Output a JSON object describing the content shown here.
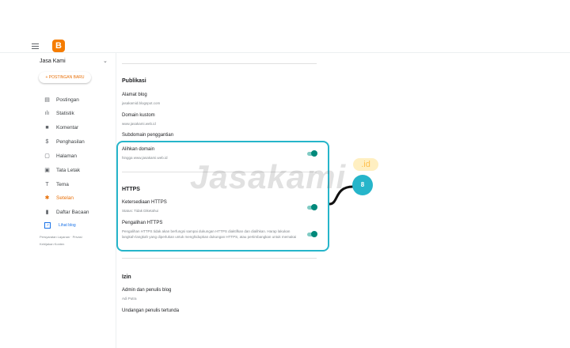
{
  "topbar": {
    "logo_letter": "B"
  },
  "sidebar": {
    "blog_name": "Jasa Kami",
    "new_post_label": "+ POSTINGAN BARU",
    "items": [
      {
        "label": "Postingan",
        "icon": "posts-icon"
      },
      {
        "label": "Statistik",
        "icon": "stats-icon"
      },
      {
        "label": "Komentar",
        "icon": "comments-icon"
      },
      {
        "label": "Penghasilan",
        "icon": "earnings-icon"
      },
      {
        "label": "Halaman",
        "icon": "pages-icon"
      },
      {
        "label": "Tata Letak",
        "icon": "layout-icon"
      },
      {
        "label": "Tema",
        "icon": "theme-icon"
      },
      {
        "label": "Setelan",
        "icon": "settings-icon"
      },
      {
        "label": "Daftar Bacaan",
        "icon": "reading-list-icon"
      }
    ],
    "view_blog_label": "Lihat blog",
    "footer_line1": "Persyaratan Layanan · Privasi",
    "footer_line2": "Kebijakan Konten"
  },
  "publikasi": {
    "title": "Publikasi",
    "blog_address_label": "Alamat blog",
    "blog_address_value": "jasakamid.blogspot.com",
    "custom_domain_label": "Domain kustom",
    "custom_domain_value": "www.jasakami.web.id",
    "fallback_subdomain_label": "Subdomain penggantian",
    "redirect_domain_label": "Alihkan domain",
    "redirect_domain_value": "hingga www.jasakami.web.id"
  },
  "https": {
    "title": "HTTPS",
    "availability_label": "Ketersediaan HTTPS",
    "availability_value": "Status: Tidak Diketahui",
    "redirect_label": "Pengalihan HTTPS",
    "redirect_value": "Pengalihan HTTPS tidak akan berfungsi sampai dukungan HTTPS diaktifkan dan dialihkan. Harap lakukan langkah-langkah yang diperlukan untuk menghidupkan dukungan HTTPS, atau pertimbangkan untuk memakai"
  },
  "izin": {
    "title": "Izin",
    "admin_label": "Admin dan penulis blog",
    "admin_value": "Adi Putra",
    "invite_label": "Undangan penulis tertunda"
  },
  "overlay": {
    "watermark_main": "Jasakami",
    "watermark_suffix": ".id",
    "step_number": "8"
  },
  "colors": {
    "accent_orange": "#e8710a",
    "toggle_teal": "#00897b",
    "highlight_cyan": "#26b5ca"
  }
}
